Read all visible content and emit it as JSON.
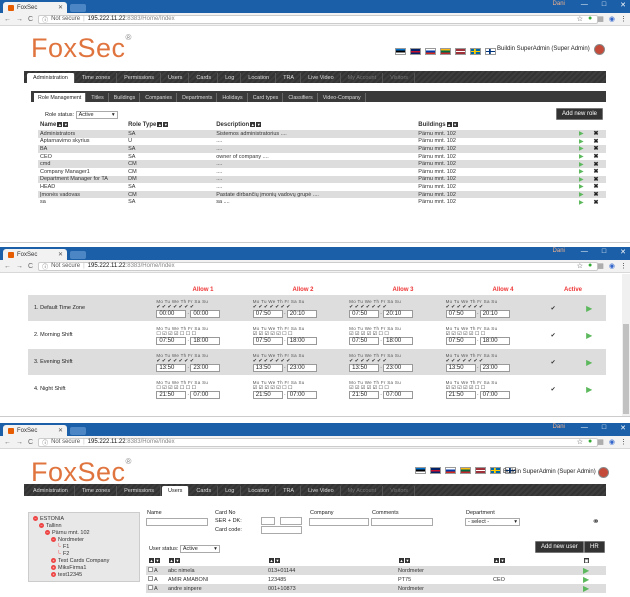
{
  "browser": {
    "tab_title": "FoxSec",
    "user_name": "Dani",
    "not_secure": "Not secure",
    "host": "195.222.11.22",
    "path": ":8383/Home/Index",
    "win_min": "—",
    "win_max": "□",
    "win_close": "✕"
  },
  "header": {
    "logo": "FoxSec",
    "logo_mark": "®",
    "user_info": "Buildin SuperAdmin (Super Admin)",
    "flags": [
      "#2c2c2c",
      "#d52b1e",
      "#d52b1e",
      "#e6b800",
      "#c8102e",
      "#006aa7",
      "#ffffff"
    ]
  },
  "nav": {
    "tabs": [
      "Administration",
      "Time zones",
      "Permissions",
      "Users",
      "Cards",
      "Log",
      "Location",
      "TRA",
      "Live Video",
      "My Account",
      "Visitors"
    ]
  },
  "admin": {
    "subtabs": [
      "Role Management",
      "Titles",
      "Buildings",
      "Companies",
      "Departments",
      "Holidays",
      "Card types",
      "Classifiers",
      "Video-Company"
    ],
    "role_status_label": "Role status:",
    "role_status_value": "Active",
    "add_role": "Add new role",
    "columns": [
      "Name",
      "Role Type",
      "Description",
      "Buildings"
    ],
    "rows": [
      {
        "name": "Administrators",
        "type": "SA",
        "desc": "Sistemos administratorius ....",
        "bld": "Pärnu mnt. 102"
      },
      {
        "name": "Aptarnavimo skyrius",
        "type": "U",
        "desc": "....",
        "bld": "Pärnu mnt. 102"
      },
      {
        "name": "BA",
        "type": "SA",
        "desc": "....",
        "bld": "Pärnu mnt. 102"
      },
      {
        "name": "CEO",
        "type": "SA",
        "desc": "owner of company ....",
        "bld": "Pärnu mnt. 102"
      },
      {
        "name": "cmd",
        "type": "CM",
        "desc": "....",
        "bld": "Pärnu mnt. 102"
      },
      {
        "name": "Company Manager1",
        "type": "CM",
        "desc": "....",
        "bld": "Pärnu mnt. 102"
      },
      {
        "name": "Department Manager for TA",
        "type": "DM",
        "desc": "....",
        "bld": "Pärnu mnt. 102"
      },
      {
        "name": "HEAD",
        "type": "SA",
        "desc": "....",
        "bld": "Pärnu mnt. 102"
      },
      {
        "name": "Įmonės vadovas",
        "type": "CM",
        "desc": "Pastate dirbančių įmonių vadovų grupė ....",
        "bld": "Pärnu mnt. 102"
      },
      {
        "name": "sa",
        "type": "SA",
        "desc": "sa ....",
        "bld": "Pärnu mnt. 102"
      }
    ]
  },
  "timezones": {
    "headers": [
      "Allow 1",
      "Allow 2",
      "Allow 3",
      "Allow 4",
      "Active"
    ],
    "days": "Mo Tu We Th Fr Sa Su",
    "rows": [
      {
        "name": "1. Default Time Zone",
        "times": [
          [
            "00:00",
            "00:00"
          ],
          [
            "07:50",
            "20:10"
          ],
          [
            "07:50",
            "20:10"
          ],
          [
            "07:50",
            "20:10"
          ]
        ],
        "active": "✔",
        "checks": [
          "✔ ✔ ✔ ✔ ✔ ✔ ✔",
          "✔ ✔ ✔ ✔ ✔ ✔ ✔",
          "✔ ✔ ✔ ✔ ✔ ✔ ✔",
          "✔ ✔ ✔ ✔ ✔ ✔ ✔"
        ]
      },
      {
        "name": "2. Morning Shift",
        "times": [
          [
            "07:50",
            "18:00"
          ],
          [
            "07:50",
            "18:00"
          ],
          [
            "07:50",
            "18:00"
          ],
          [
            "07:50",
            "18:00"
          ]
        ],
        "active": "✔",
        "checks": [
          "☐ ☑ ☑ ☑ ☐ ☐ ☐",
          "☑ ☑ ☑ ☑ ☑ ☐ ☐",
          "☑ ☑ ☑ ☑ ☑ ☐ ☐",
          "☑ ☑ ☑ ☑ ☑ ☐ ☐"
        ]
      },
      {
        "name": "3. Evening Shift",
        "times": [
          [
            "13:50",
            "23:00"
          ],
          [
            "13:50",
            "23:00"
          ],
          [
            "13:50",
            "23:00"
          ],
          [
            "13:50",
            "23:00"
          ]
        ],
        "active": "✔",
        "checks": [
          "✔ ✔ ✔ ✔ ✔ ✔ ✔",
          "✔ ✔ ✔ ✔ ✔ ✔ ✔",
          "✔ ✔ ✔ ✔ ✔ ✔ ✔",
          "✔ ✔ ✔ ✔ ✔ ✔ ✔"
        ]
      },
      {
        "name": "4. Night Shift",
        "times": [
          [
            "21:50",
            "07:00"
          ],
          [
            "21:50",
            "07:00"
          ],
          [
            "21:50",
            "07:00"
          ],
          [
            "21:50",
            "07:00"
          ]
        ],
        "active": "✔",
        "checks": [
          "☐ ☑ ☑ ☑ ☐ ☐ ☐",
          "☑ ☑ ☑ ☑ ☑ ☐ ☐",
          "☑ ☑ ☑ ☑ ☑ ☐ ☐",
          "☑ ☑ ☑ ☑ ☑ ☐ ☐"
        ]
      }
    ]
  },
  "users": {
    "tree": [
      {
        "label": "ESTONIA",
        "indent": 0,
        "mark": "minus"
      },
      {
        "label": "Tallinn",
        "indent": 1,
        "mark": "minus"
      },
      {
        "label": "Pärnu mnt. 102",
        "indent": 2,
        "mark": "minus"
      },
      {
        "label": "Nordmeter",
        "indent": 3,
        "mark": "minus"
      },
      {
        "label": "F1",
        "indent": 4,
        "mark": "none"
      },
      {
        "label": "F2",
        "indent": 4,
        "mark": "none"
      },
      {
        "label": "Test Cards Company",
        "indent": 3,
        "mark": "plus"
      },
      {
        "label": "MiksFirma1",
        "indent": 3,
        "mark": "plus"
      },
      {
        "label": "test12345",
        "indent": 3,
        "mark": "plus"
      }
    ],
    "filters": {
      "name": "Name",
      "card_no": "Card No",
      "ser_dk": "SER + DK:",
      "card_code": "Card code:",
      "company": "Company",
      "comments": "Comments",
      "department": "Department",
      "select": "- select -"
    },
    "user_status_label": "User status:",
    "user_status_value": "Active",
    "add_user": "Add new user",
    "hr": "HR",
    "rows": [
      {
        "mark": "A",
        "name": "abc nimela",
        "card": "013+01144",
        "company": "Nordmeter",
        "dept": ""
      },
      {
        "mark": "A",
        "name": "AMIR AMABONI",
        "card": "123485",
        "company": "PT75",
        "dept": "CEO"
      },
      {
        "mark": "A",
        "name": "andre sinpere",
        "card": "001+10873",
        "company": "Nordmeter",
        "dept": ""
      }
    ]
  }
}
